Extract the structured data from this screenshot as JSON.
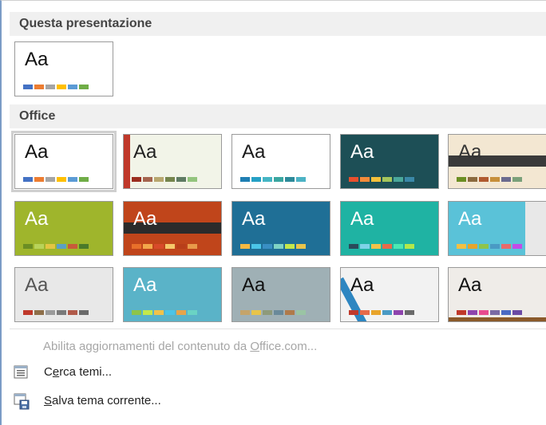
{
  "section_this": {
    "title": "Questa presentazione"
  },
  "section_office": {
    "title": "Office"
  },
  "aa_label": "Aa",
  "palette": {
    "default": [
      "#4472c4",
      "#ed7d31",
      "#a5a5a5",
      "#ffc000",
      "#5b9bd5",
      "#70ad47"
    ]
  },
  "themes": [
    {
      "id": "office",
      "bg": "#ffffff",
      "aa_color": "#111111",
      "colors": [
        "#4472c4",
        "#ed7d31",
        "#a5a5a5",
        "#ffc000",
        "#5b9bd5",
        "#70ad47"
      ]
    },
    {
      "id": "facet",
      "bg": "#f2f4e8",
      "aa_color": "#222222",
      "colors": [
        "#9b2d1f",
        "#a5644e",
        "#b8a76f",
        "#75854d",
        "#5f7b63",
        "#93c47d"
      ]
    },
    {
      "id": "ion-pattern",
      "bg": "#7ec0da",
      "aa_color": "#1a1a1a",
      "colors": [
        "#1f7fb3",
        "#25a0c5",
        "#45b5c4",
        "#3aa6a0",
        "#2d8a9a",
        "#4cb3c5"
      ]
    },
    {
      "id": "ion-dark",
      "bg": "#1d4f56",
      "aa_color": "#ffffff",
      "colors": [
        "#e94f2d",
        "#f28b3a",
        "#f5c13b",
        "#a4c65c",
        "#4aa89b",
        "#3b88a8"
      ]
    },
    {
      "id": "retrospect",
      "bg": "#f3e7d2",
      "aa_color": "#333333",
      "colors": [
        "#6b8e23",
        "#8b6a3e",
        "#b05a2f",
        "#c78f3a",
        "#6a6a8e",
        "#7aa07a"
      ]
    },
    {
      "id": "green",
      "bg": "#9fb52c",
      "aa_color": "#ffffff",
      "colors": [
        "#6b8e23",
        "#b8d35a",
        "#e3c542",
        "#5aa0c5",
        "#c85a3a",
        "#4a7a2a"
      ]
    },
    {
      "id": "orange-red",
      "bg": "#c0451b",
      "aa_color": "#ffffff",
      "colors": [
        "#e8702a",
        "#f2a74a",
        "#d84a2a",
        "#f5c86a",
        "#b83e1a",
        "#e89a4a"
      ]
    },
    {
      "id": "blue-teal",
      "bg": "#1f6f96",
      "aa_color": "#ffffff",
      "colors": [
        "#f4b942",
        "#4bc5e8",
        "#3a8fc4",
        "#7ed3c4",
        "#c4e84b",
        "#e8c44b"
      ]
    },
    {
      "id": "turquoise",
      "bg": "#1fb3a3",
      "aa_color": "#ffffff",
      "colors": [
        "#2a4a5a",
        "#7ed3e8",
        "#f2c24a",
        "#e86a4a",
        "#4ae8b3",
        "#b3e84a"
      ]
    },
    {
      "id": "light-blue",
      "bg": "#5ac2d8",
      "aa_color": "#ffffff",
      "colors": [
        "#f4c042",
        "#e8a42a",
        "#8ec44a",
        "#4a9ac4",
        "#e86a6a",
        "#c44ae8"
      ]
    },
    {
      "id": "grey-texture",
      "bg": "#e8e8e8",
      "aa_color": "#555555",
      "colors": [
        "#c0392b",
        "#8e6f4a",
        "#9a9a9a",
        "#7a7a7a",
        "#b05a4a",
        "#6a6a6a"
      ]
    },
    {
      "id": "sky-blue",
      "bg": "#5ab3c8",
      "aa_color": "#ffffff",
      "colors": [
        "#8ec44a",
        "#c4e84b",
        "#f2c24a",
        "#4ac4e8",
        "#e8a44a",
        "#6ad3c4"
      ]
    },
    {
      "id": "slate",
      "bg": "#9fb0b5",
      "aa_color": "#111111",
      "colors": [
        "#c4a46a",
        "#e8c44a",
        "#8e9a7a",
        "#6a8a9a",
        "#b07a4a",
        "#9ac4a4"
      ]
    },
    {
      "id": "ribbon",
      "bg": "#f2f2f2",
      "aa_color": "#111111",
      "colors": [
        "#c0392b",
        "#e86a4a",
        "#e8a42a",
        "#4a9ac4",
        "#8e44ad",
        "#6a6a6a"
      ]
    },
    {
      "id": "wood",
      "bg": "#efece8",
      "aa_color": "#111111",
      "colors": [
        "#c0392b",
        "#8e44ad",
        "#e84a8e",
        "#7a6aa4",
        "#4a6ac4",
        "#6a4aa4"
      ]
    }
  ],
  "menu": {
    "enable_updates": "Abilita aggiornamenti del contenuto da Office.com...",
    "browse_themes": "Cerca temi...",
    "save_theme": "Salva tema corrente..."
  }
}
